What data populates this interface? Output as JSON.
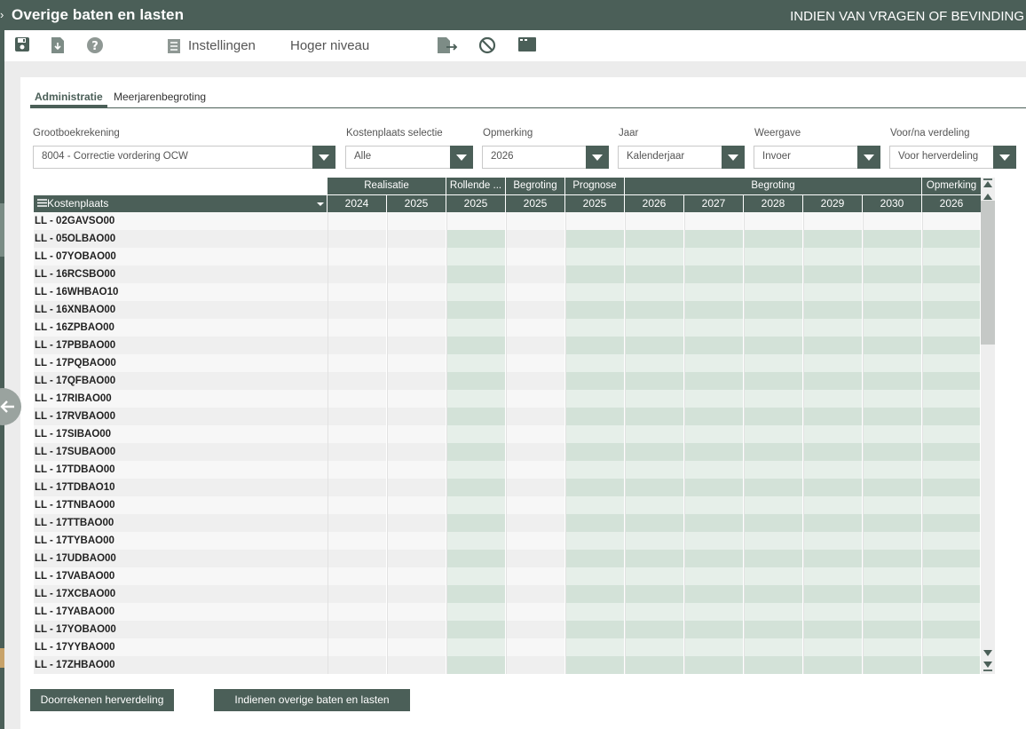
{
  "header": {
    "title": "Overige baten en lasten",
    "notice": "INDIEN VAN VRAGEN OF BEVINDING"
  },
  "toolbar": {
    "settings_label": "Instellingen",
    "up_level_label": "Hoger niveau"
  },
  "tabs": [
    {
      "label": "Administratie",
      "active": true
    },
    {
      "label": "Meerjarenbegroting",
      "active": false
    }
  ],
  "filters": {
    "grootboek": {
      "label": "Grootboekrekening",
      "value": "8004 - Correctie vordering OCW"
    },
    "kostenplaats": {
      "label": "Kostenplaats selectie",
      "value": "Alle"
    },
    "opmerking": {
      "label": "Opmerking",
      "value": "2026"
    },
    "jaar": {
      "label": "Jaar",
      "value": "Kalenderjaar"
    },
    "weergave": {
      "label": "Weergave",
      "value": "Invoer"
    },
    "verdeling": {
      "label": "Voor/na verdeling",
      "value": "Voor herverdeling"
    }
  },
  "grid": {
    "first_column_header": "Kostenplaats",
    "group_headers": [
      "Realisatie",
      "Rollende ...",
      "Begroting",
      "Prognose",
      "Begroting",
      "Opmerking"
    ],
    "year_headers": [
      "2024",
      "2025",
      "2025",
      "2025",
      "2025",
      "2026",
      "2027",
      "2028",
      "2029",
      "2030",
      "2026"
    ],
    "rows": [
      "LL - 02GAVSO00",
      "LL - 05OLBAO00",
      "LL - 07YOBAO00",
      "LL - 16RCSBO00",
      "LL - 16WHBAO10",
      "LL - 16XNBAO00",
      "LL - 16ZPBAO00",
      "LL - 17PBBAO00",
      "LL - 17PQBAO00",
      "LL - 17QFBAO00",
      "LL - 17RIBAO00",
      "LL - 17RVBAO00",
      "LL - 17SIBAO00",
      "LL - 17SUBAO00",
      "LL - 17TDBAO00",
      "LL - 17TDBAO10",
      "LL - 17TNBAO00",
      "LL - 17TTBAO00",
      "LL - 17TYBAO00",
      "LL - 17UDBAO00",
      "LL - 17VABAO00",
      "LL - 17XCBAO00",
      "LL - 17YABAO00",
      "LL - 17YOBAO00",
      "LL - 17YYBAO00",
      "LL - 17ZHBAO00"
    ]
  },
  "buttons": {
    "recalc": "Doorrekenen herverdeling",
    "submit": "Indienen overige baten en lasten"
  },
  "colors": {
    "primary": "#4b5f58",
    "editable_light": "#e6efe9",
    "editable_dark": "#d3e2d8",
    "row_light": "#f7f7f7",
    "row_dark": "#efefef"
  }
}
